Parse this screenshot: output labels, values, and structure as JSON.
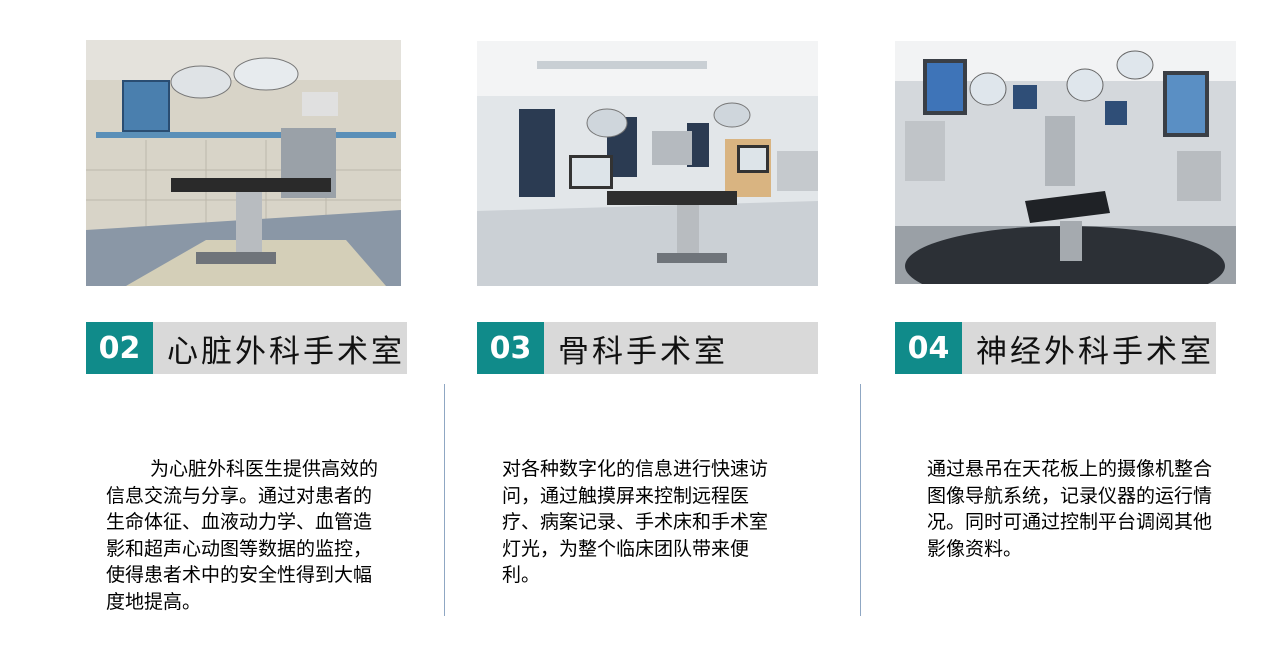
{
  "cards": [
    {
      "number": "02",
      "title": "心脏外科手术室",
      "description": "为心脏外科医生提供高效的信息交流与分享。通过对患者的生命体征、血液动力学、血管造影和超声心动图等数据的监控，使得患者术中的安全性得到大幅度地提高。",
      "photo": "cardiac-operating-room-photo"
    },
    {
      "number": "03",
      "title": "骨科手术室",
      "description": "对各种数字化的信息进行快速访问，通过触摸屏来控制远程医疗、病案记录、手术床和手术室灯光，为整个临床团队带来便利。",
      "photo": "orthopedic-operating-room-photo"
    },
    {
      "number": "04",
      "title": "神经外科手术室",
      "description": "通过悬吊在天花板上的摄像机整合图像导航系统，记录仪器的运行情况。同时可通过控制平台调阅其他影像资料。",
      "photo": "neurosurgery-operating-room-photo"
    }
  ],
  "colors": {
    "accent": "#108b8a",
    "title_bar": "#d9d9d9",
    "divider": "#8fa7c3"
  }
}
